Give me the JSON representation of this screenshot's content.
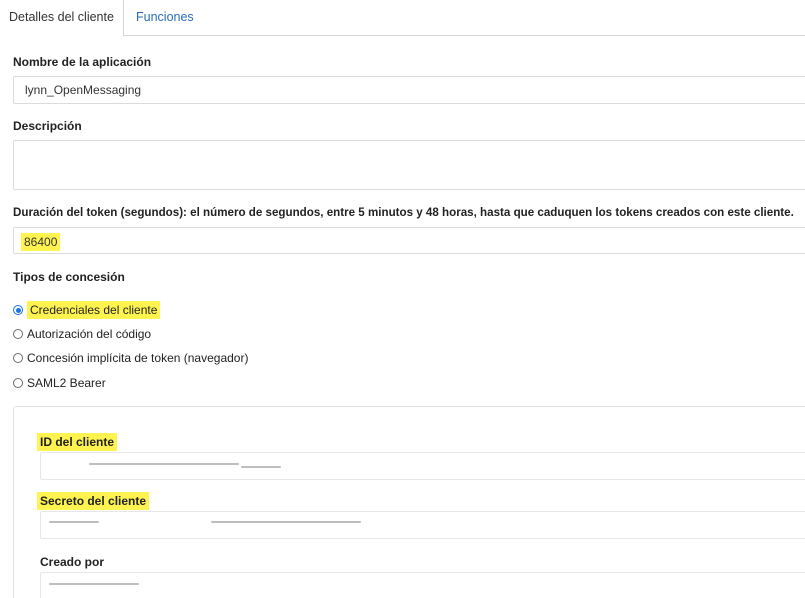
{
  "tabs": [
    {
      "label": "Detalles del cliente",
      "active": true
    },
    {
      "label": "Funciones",
      "active": false
    }
  ],
  "app_name": {
    "label": "Nombre de la aplicación",
    "value": "lynn_OpenMessaging"
  },
  "description": {
    "label": "Descripción",
    "value": ""
  },
  "token_duration": {
    "label": "Duración del token (segundos): el número de segundos, entre 5 minutos y 48 horas, hasta que caduquen los tokens creados con este cliente.",
    "value": "86400"
  },
  "grant_types": {
    "label": "Tipos de concesión",
    "options": [
      {
        "label": "Credenciales del cliente",
        "checked": true
      },
      {
        "label": "Autorización del código",
        "checked": false
      },
      {
        "label": "Concesión implícita de token (navegador)",
        "checked": false
      },
      {
        "label": "SAML2 Bearer",
        "checked": false
      }
    ]
  },
  "client_id": {
    "label": "ID del cliente"
  },
  "client_secret": {
    "label": "Secreto del cliente"
  },
  "created_by": {
    "label": "Creado por"
  },
  "colors": {
    "highlight": "#fff44f",
    "link": "#2a6ebb",
    "radio_selected": "#1a73e8"
  }
}
